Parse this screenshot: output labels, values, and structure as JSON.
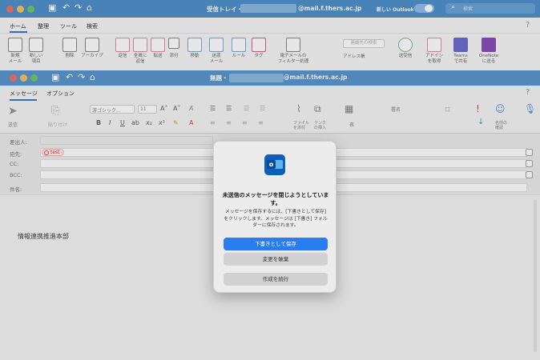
{
  "main_window": {
    "title_prefix": "受信トレイ・",
    "title_email": "@mail.f.thers.ac.jp",
    "new_outlook_label": "新しい Outlook",
    "search_placeholder": "検索",
    "menu": [
      "ホーム",
      "整理",
      "ツール",
      "検索"
    ],
    "ribbon": [
      {
        "icon": "envelope-icon",
        "label": "新規\nメール"
      },
      {
        "icon": "new-items-icon",
        "label": "新しい\n項目"
      },
      {
        "icon": "trash-icon",
        "label": "削除"
      },
      {
        "icon": "archive-icon",
        "label": "アーカイブ"
      },
      {
        "icon": "reply-icon",
        "label": "返信"
      },
      {
        "icon": "reply-all-icon",
        "label": "全員に\n返信"
      },
      {
        "icon": "forward-icon",
        "label": "転送"
      },
      {
        "icon": "more-icon",
        "label": "添付"
      },
      {
        "icon": "move-icon",
        "label": "移動"
      },
      {
        "icon": "rules-icon",
        "label": "迷惑\nメール"
      },
      {
        "icon": "rules-icon",
        "label": "ルール"
      },
      {
        "icon": "flag-icon",
        "label": "タグ"
      },
      {
        "icon": "filter-icon",
        "label": "電子メールの\nフィルター処理"
      },
      {
        "icon": "address-book-icon",
        "label": "アドレス帳"
      },
      {
        "icon": "sync-icon",
        "label": "送受信"
      },
      {
        "icon": "addin-icon",
        "label": "アドイン\nを取得"
      },
      {
        "icon": "teams-icon",
        "label": "Teams\nで共有"
      },
      {
        "icon": "onenote-icon",
        "label": "OneNote\nに送る"
      }
    ],
    "search_people_placeholder": "連絡先の検索"
  },
  "compose_window": {
    "title_prefix": "無題・",
    "title_email": "@mail.f.thers.ac.jp",
    "tabs": [
      "メッセージ",
      "オプション"
    ],
    "ribbon": {
      "send_label": "送信",
      "paste_label": "貼り付け",
      "font_name": "游ゴシック...",
      "font_size": "11",
      "attach_label": "ファイル\nを添付",
      "link_label": "リンク\nの挿入",
      "table_label": "表",
      "signature_label": "署名",
      "dictation_label": "ディクテーション",
      "sensitivity_label": "名前の\n確認",
      "importance_label": "ディクテーション"
    },
    "headers": {
      "from_label": "差出人:",
      "to_label": "宛先:",
      "cc_label": "CC:",
      "bcc_label": "BCC:",
      "subject_label": "件名:",
      "recipient": "test"
    },
    "body_signature": "情報連携推進本部"
  },
  "dialog": {
    "title": "未送信のメッセージを閉じようとしています。",
    "message": "メッセージを保存するには、[下書きとして保存] をクリックします。メッセージは [下書き] フォルダーに保存されます。",
    "save_draft": "下書きとして保存",
    "discard": "変更を破棄",
    "continue": "作成を続行"
  },
  "colors": {
    "title_bar": "#3d86c6",
    "accent": "#2a7cf0"
  }
}
